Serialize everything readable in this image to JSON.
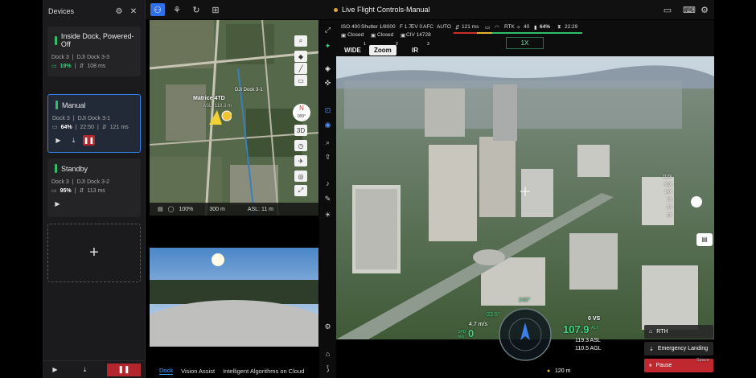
{
  "devices": {
    "title": "Devices",
    "cards": [
      {
        "title": "Inside Dock, Powered-Off",
        "dock": "Dock 3",
        "dock_name": "DJI Dock 3-3",
        "battery": "19%",
        "latency": "108 ms"
      },
      {
        "title": "Manual",
        "dock": "Dock 3",
        "dock_name": "DJI Dock 3-1",
        "battery": "64%",
        "time": "22:50",
        "latency": "121 ms"
      },
      {
        "title": "Standby",
        "dock": "Dock 3",
        "dock_name": "DJI Dock 3-2",
        "battery": "95%",
        "latency": "113 ms"
      }
    ],
    "add_label": "+"
  },
  "topbar": {
    "title": "Live Flight Controls-Manual"
  },
  "map": {
    "drone_label": "Matrice 4TD",
    "drone_asl": "ASL: 119.3 m",
    "dock_label": "DJI Dock 3-1",
    "compass_n": "N",
    "compass_deg": "000°",
    "btn_3d": "3D",
    "zoom_pct": "100%",
    "scale": "300 m",
    "asl": "ASL: 11 m"
  },
  "fpv_tabs": [
    "Dock",
    "Vision Assist",
    "Intelligent Algorithms on Cloud"
  ],
  "camera": {
    "iso": "ISO 400",
    "shutter": "Shutter 1/8000",
    "f": "F 1.7",
    "ev": "EV 0",
    "afc": "AFC",
    "auto": "AUTO",
    "closed1": "Closed",
    "closed2": "Closed",
    "civ": "CIV 14728",
    "latency": "121 ms",
    "rtk": "RTK",
    "rtk_count": "40",
    "battery": "64%",
    "time": "22:29",
    "lenses": [
      "WIDE",
      "Zoom",
      "IR"
    ],
    "lens_nums": [
      "1",
      "2",
      "3"
    ],
    "zoom": "1X",
    "zoom_scale": [
      "112X",
      "56X",
      "14X",
      "7X",
      "2X",
      "1X"
    ],
    "pitch": "-22.5°",
    "heading": "240°",
    "hspeed": "4.7 m/s",
    "spd": "0",
    "vs": "0 VS",
    "alt": "107.9",
    "alt_unit": "ALT",
    "asl": "119.3 ASL",
    "agl": "110.5 AGL",
    "dist": "120 m",
    "spd_label": "SPD m/s"
  },
  "controls": {
    "rth": "RTH",
    "emergency": "Emergency Landing",
    "pause": "Pause",
    "space": "Space"
  }
}
